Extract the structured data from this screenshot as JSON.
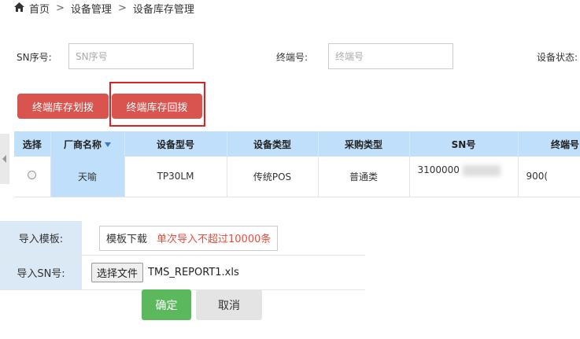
{
  "breadcrumb": {
    "home": "首页",
    "sep": ">",
    "level1": "设备管理",
    "level2": "设备库存管理"
  },
  "search": {
    "sn_label": "SN序号:",
    "sn_placeholder": "SN序号",
    "terminal_label": "终端号:",
    "terminal_placeholder": "终端号",
    "status_label": "设备状态:"
  },
  "actions": {
    "allocate": "终端库存划拨",
    "recall": "终端库存回拨"
  },
  "table": {
    "headers": [
      "选择",
      "厂商名称",
      "设备型号",
      "设备类型",
      "采购类型",
      "SN号",
      "终端号"
    ],
    "rows": [
      {
        "vendor": "天喻",
        "model": "TP30LM",
        "type": "传统POS",
        "purchase": "普通类",
        "sn": "3100000",
        "terminal": "900("
      }
    ]
  },
  "form": {
    "template_label": "导入模板:",
    "template_link": "模板下载",
    "template_note": "单次导入不超过10000条",
    "sn_label": "导入SN号:",
    "file_button": "选择文件",
    "file_name": "TMS_REPORT1.xls"
  },
  "buttons": {
    "ok": "确定",
    "cancel": "取消"
  },
  "colors": {
    "danger": "#d9534f",
    "success": "#5cb85c",
    "header_blue": "#bfdffa",
    "highlight": "#e02020"
  }
}
